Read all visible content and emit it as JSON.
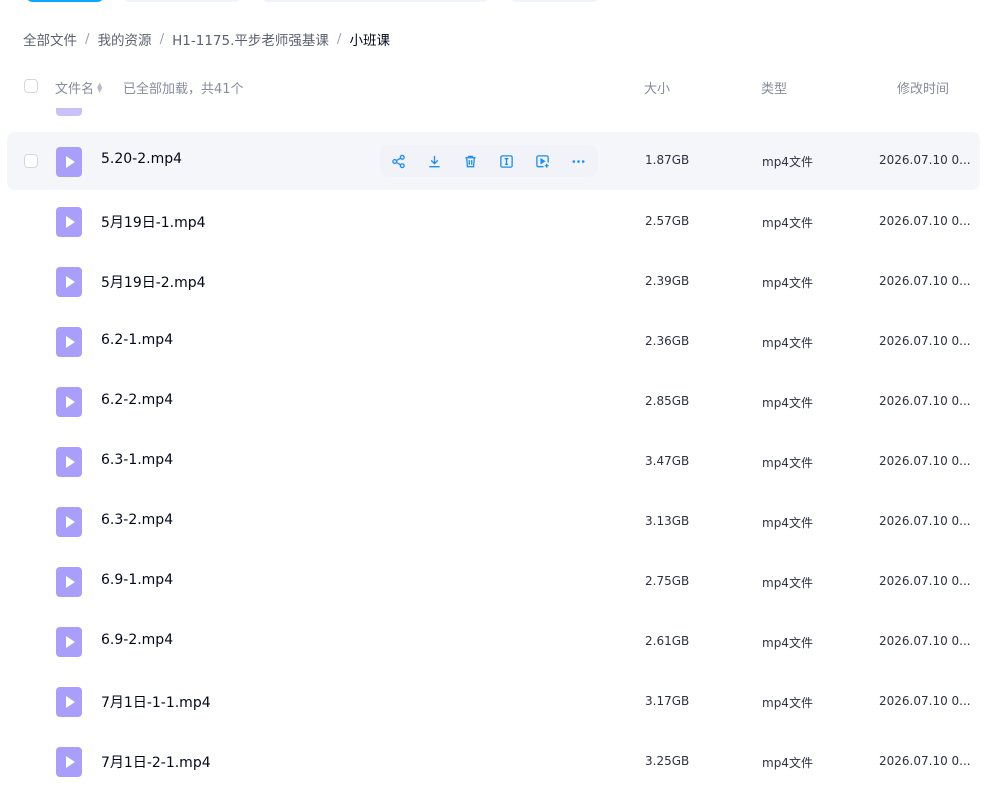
{
  "breadcrumb": {
    "items": [
      "全部文件",
      "我的资源",
      "H1-1175.平步老师强基课"
    ],
    "current": "小班课",
    "separator": "/"
  },
  "header": {
    "name": "文件名",
    "count": "已全部加载，共41个",
    "size": "大小",
    "type": "类型",
    "mtime": "修改时间"
  },
  "hover_actions": [
    "share-icon",
    "download-icon",
    "delete-icon",
    "rename-icon",
    "add-to-playlist-icon",
    "more-icon"
  ],
  "files": [
    {
      "name": "5.20-2.mp4",
      "size": "1.87GB",
      "type": "mp4文件",
      "mtime": "2026.07.10 0..."
    },
    {
      "name": "5月19日-1.mp4",
      "size": "2.57GB",
      "type": "mp4文件",
      "mtime": "2026.07.10 0..."
    },
    {
      "name": "5月19日-2.mp4",
      "size": "2.39GB",
      "type": "mp4文件",
      "mtime": "2026.07.10 0..."
    },
    {
      "name": "6.2-1.mp4",
      "size": "2.36GB",
      "type": "mp4文件",
      "mtime": "2026.07.10 0..."
    },
    {
      "name": "6.2-2.mp4",
      "size": "2.85GB",
      "type": "mp4文件",
      "mtime": "2026.07.10 0..."
    },
    {
      "name": "6.3-1.mp4",
      "size": "3.47GB",
      "type": "mp4文件",
      "mtime": "2026.07.10 0..."
    },
    {
      "name": "6.3-2.mp4",
      "size": "3.13GB",
      "type": "mp4文件",
      "mtime": "2026.07.10 0..."
    },
    {
      "name": "6.9-1.mp4",
      "size": "2.75GB",
      "type": "mp4文件",
      "mtime": "2026.07.10 0..."
    },
    {
      "name": "6.9-2.mp4",
      "size": "2.61GB",
      "type": "mp4文件",
      "mtime": "2026.07.10 0..."
    },
    {
      "name": "7月1日-1-1.mp4",
      "size": "3.17GB",
      "type": "mp4文件",
      "mtime": "2026.07.10 0..."
    },
    {
      "name": "7月1日-2-1.mp4",
      "size": "3.25GB",
      "type": "mp4文件",
      "mtime": "2026.07.10 0..."
    }
  ],
  "colors": {
    "accent": "#06a7ff",
    "icon_video": "#a99ef9",
    "action_blue": "#1c8df6",
    "hover_row": "#f5f6fa"
  }
}
